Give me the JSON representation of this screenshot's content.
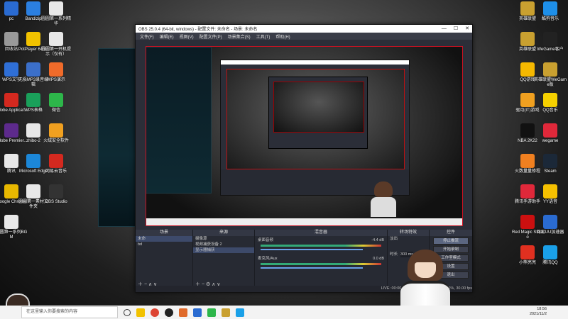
{
  "desktop_left": [
    {
      "label": "pc",
      "color": "#2a6bd1"
    },
    {
      "label": "Bandizip",
      "color": "#2b7fe0"
    },
    {
      "label": "圆圆第一系列精华",
      "color": "#e8e8e8"
    },
    {
      "label": "回收站",
      "color": "#999"
    },
    {
      "label": "PotPlayer 64 bit",
      "color": "#f2c200"
    },
    {
      "label": "圆圆第一开机提示（仅有）",
      "color": "#e8e8e8"
    },
    {
      "label": "WPS文字",
      "color": "#2f6fd6"
    },
    {
      "label": "无损MP3录音编辑",
      "color": "#3b6fc9"
    },
    {
      "label": "WPS演示",
      "color": "#f06b2a"
    },
    {
      "label": "Adobe Applicat...",
      "color": "#d4291f"
    },
    {
      "label": "WPS表格",
      "color": "#1aa05a"
    },
    {
      "label": "微信",
      "color": "#2db64a"
    },
    {
      "label": "Adobe Premier...",
      "color": "#5d2a8c"
    },
    {
      "label": "zhibo-2",
      "color": "#e8e8e8"
    },
    {
      "label": "火绒安全软件",
      "color": "#f0a020"
    },
    {
      "label": "腾讯",
      "color": "#e8e8e8"
    },
    {
      "label": "Microsoft Edge",
      "color": "#1c87d8"
    },
    {
      "label": "网易云音乐",
      "color": "#d4291f"
    },
    {
      "label": "Google Chrome",
      "color": "#e8b800"
    },
    {
      "label": "圆圆第一素材文件夹",
      "color": "#e8e8e8"
    },
    {
      "label": "OBS Studio",
      "color": "#333"
    },
    {
      "label": "圆圆第一系列BGM",
      "color": "#e8e8e8"
    }
  ],
  "desktop_right": [
    {
      "label": "英雄联盟",
      "color": "#c9a030"
    },
    {
      "label": "酷狗音乐",
      "color": "#1e8fe8"
    },
    {
      "label": "英雄联盟",
      "color": "#c9a030"
    },
    {
      "label": "WeGame客户",
      "color": "#222"
    },
    {
      "label": "QQ游戏",
      "color": "#f5b800"
    },
    {
      "label": "英雄联盟WeGame版",
      "color": "#c9a030"
    },
    {
      "label": "驱动(IT)游戏",
      "color": "#f0a020"
    },
    {
      "label": "QQ音乐",
      "color": "#f5d000"
    },
    {
      "label": "NBA 2K22",
      "color": "#111"
    },
    {
      "label": "wegame",
      "color": "#e0283a"
    },
    {
      "label": "火数量量修程",
      "color": "#f08020"
    },
    {
      "label": "Steam",
      "color": "#1b2838"
    },
    {
      "label": "腾讯手游助手",
      "color": "#e0283a"
    },
    {
      "label": "YY语音",
      "color": "#f5c000"
    },
    {
      "label": "Red Magic Studio",
      "color": "#cc1010"
    },
    {
      "label": "网易UU加速器",
      "color": "#2a6bd1"
    },
    {
      "label": "小熊亮亮",
      "color": "#e03020"
    },
    {
      "label": "腾讯QQ",
      "color": "#1aa0e8"
    }
  ],
  "obs": {
    "title": "OBS 25.0.4 (64-bit, windows) - 配置文件: 未命名 - 场景: 未命名",
    "menu": [
      "文件(F)",
      "编辑(E)",
      "视图(V)",
      "配置文件(P)",
      "场景集合(S)",
      "工具(T)",
      "帮助(H)"
    ],
    "docks": {
      "scenes": {
        "title": "场景",
        "items": [
          "未命",
          "bd"
        ]
      },
      "sources": {
        "title": "来源",
        "items": [
          "摄像源",
          "视频捕获设备 2",
          "显示器捕获"
        ]
      },
      "mixer": {
        "title": "混音器",
        "tracks": [
          {
            "name": "桌面音频",
            "db": "-4.4 dB"
          },
          {
            "name": "麦克风/Aux",
            "db": "0.0 dB"
          }
        ]
      },
      "transitions": {
        "title": "转场特效",
        "type": "淡出",
        "duration_label": "时长",
        "duration": "300 ms"
      },
      "controls": {
        "title": "控件",
        "buttons": [
          "停止推流",
          "开始录制",
          "工作室模式",
          "设置",
          "退出"
        ]
      }
    },
    "status": "LIVE: 00:00:00   REC: 00:00:00   CPU: 3.5%, 30.00 fps"
  },
  "taskbar": {
    "search_placeholder": "在这里输入你要搜索的内容",
    "time": "18:56",
    "date": "2021/11/2"
  }
}
